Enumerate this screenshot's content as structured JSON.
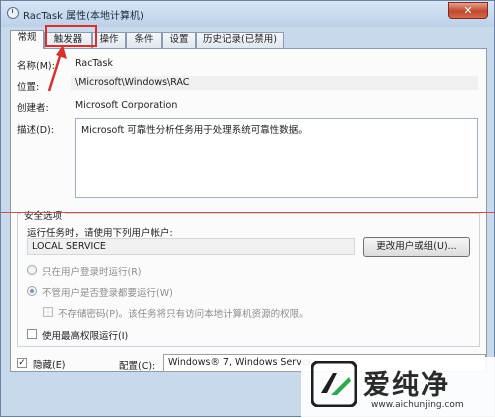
{
  "window": {
    "title": "RacTask 属性(本地计算机)",
    "close_glyph": "✕"
  },
  "tabs": [
    {
      "label": "常规",
      "active": true
    },
    {
      "label": "触发器",
      "active": false
    },
    {
      "label": "操作",
      "active": false
    },
    {
      "label": "条件",
      "active": false
    },
    {
      "label": "设置",
      "active": false
    },
    {
      "label": "历史记录(已禁用)",
      "active": false
    }
  ],
  "general": {
    "name_label": "名称(M):",
    "name_value": "RacTask",
    "location_label": "位置:",
    "location_value": "\\Microsoft\\Windows\\RAC",
    "author_label": "创建者:",
    "author_value": "Microsoft Corporation",
    "description_label": "描述(D):",
    "description_value": "Microsoft 可靠性分析任务用于处理系统可靠性数据。"
  },
  "security": {
    "group_title": "安全选项",
    "run_as_label": "运行任务时，请使用下列用户帐户:",
    "account_value": "LOCAL SERVICE",
    "change_button": "更改用户或组(U)...",
    "radio_logged_on": "只在用户登录时运行(R)",
    "radio_any": "不管用户是否登录都要运行(W)",
    "no_store_password": "不存储密码(P)。该任务将只有访问本地计算机资源的权限。",
    "highest_privileges": "使用最高权限运行(I)"
  },
  "bottom": {
    "hidden_label": "隐藏(E)",
    "hidden_checked": true,
    "configure_label": "配置(C):",
    "configure_value": "Windows® 7, Windows Server"
  },
  "watermark": {
    "text": "爱纯净",
    "url": "www.aichunjing.com"
  }
}
